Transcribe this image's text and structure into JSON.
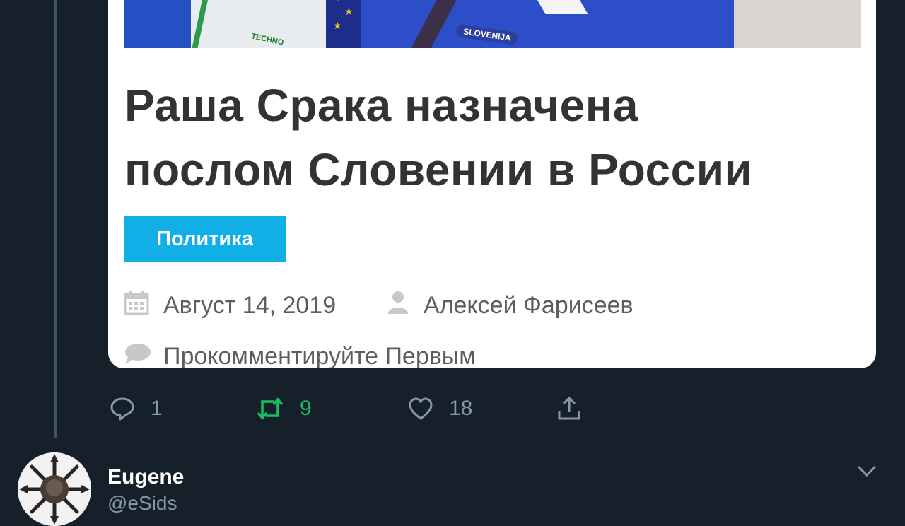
{
  "article": {
    "headline_line1": "Раша Срака назначена",
    "headline_line2": "послом Словении в России",
    "category": "Политика",
    "date": "Август 14, 2019",
    "author": "Алексей Фарисеев",
    "comment_prompt": "Прокомментируйте Первым",
    "photo_text_techno": "TECHNO",
    "photo_text_badge": "SLOVENIJA"
  },
  "actions": {
    "reply_count": "1",
    "retweet_count": "9",
    "like_count": "18"
  },
  "next_tweet": {
    "display_name": "Eugene",
    "handle": "@eSids"
  },
  "colors": {
    "background": "#15202b",
    "category_bg": "#12aee6",
    "retweet_active": "#17bf63",
    "action_gray": "#8899a6"
  },
  "icons": {
    "date": "calendar-icon",
    "author": "user-icon",
    "comments": "comment-bubble-icon",
    "reply": "reply-icon",
    "retweet": "retweet-icon",
    "like": "heart-icon",
    "share": "share-icon",
    "menu": "chevron-down-icon"
  }
}
